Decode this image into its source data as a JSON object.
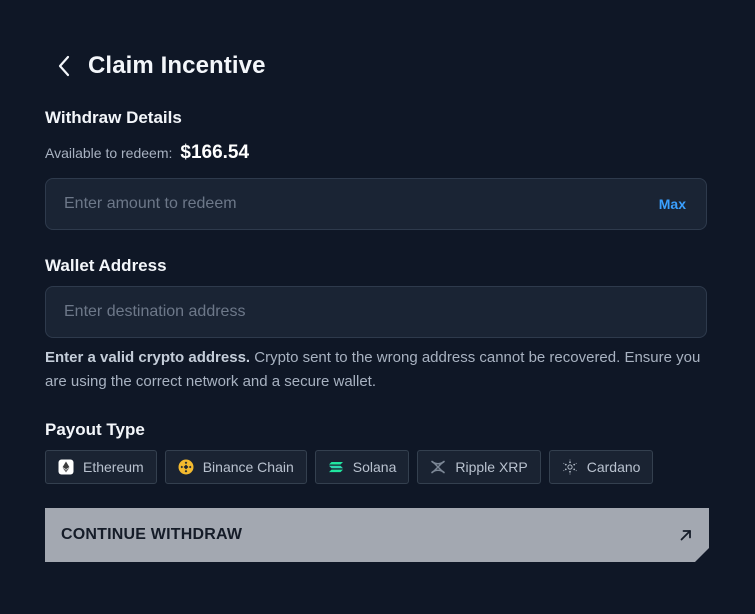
{
  "header": {
    "title": "Claim Incentive"
  },
  "withdraw": {
    "section_title": "Withdraw Details",
    "available_label": "Available to redeem:",
    "available_value": "$166.54",
    "amount_placeholder": "Enter amount to redeem",
    "max_label": "Max"
  },
  "wallet": {
    "section_title": "Wallet Address",
    "address_placeholder": "Enter destination address",
    "note_bold": "Enter a valid crypto address.",
    "note_text": " Crypto sent to the wrong address cannot be recovered. Ensure you are using the correct network and a secure wallet."
  },
  "payout": {
    "section_title": "Payout Type",
    "options": [
      {
        "label": "Ethereum",
        "icon": "ethereum-icon"
      },
      {
        "label": "Binance Chain",
        "icon": "binance-icon"
      },
      {
        "label": "Solana",
        "icon": "solana-icon"
      },
      {
        "label": "Ripple XRP",
        "icon": "ripple-icon"
      },
      {
        "label": "Cardano",
        "icon": "cardano-icon"
      }
    ]
  },
  "actions": {
    "continue_label": "CONTINUE WITHDRAW"
  },
  "colors": {
    "background": "#0f1726",
    "field_bg": "#1a2434",
    "accent": "#3aa0ff",
    "button_bg": "#a3a8b1"
  }
}
